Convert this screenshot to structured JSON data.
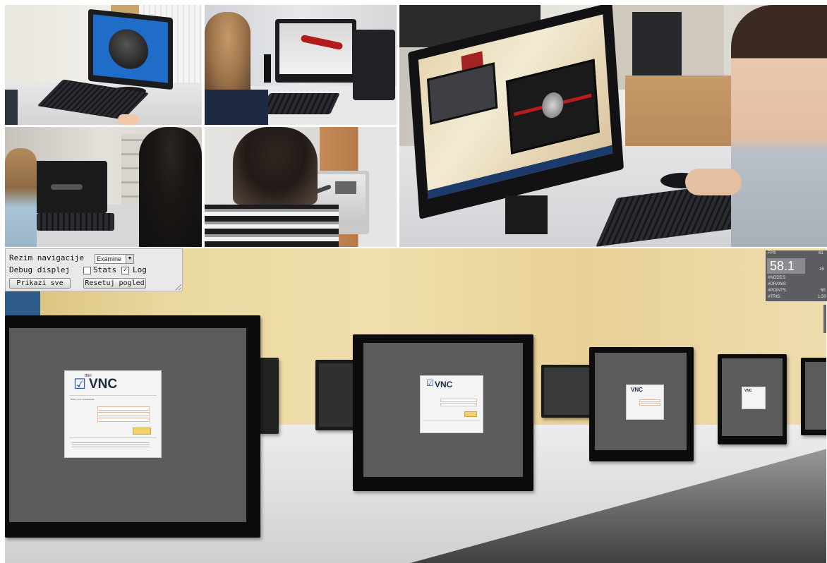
{
  "panel": {
    "nav_label": "Rezim navigacije",
    "nav_select": "Examine",
    "debug_label": "Debug displej",
    "stats_label": "Stats",
    "stats_checked": false,
    "log_label": "Log",
    "log_checked": true,
    "show_all_button": "Prikazi sve",
    "reset_view_button": "Resetuj pogled"
  },
  "stats": {
    "header_left": "FPS",
    "header_right": "61",
    "fps_value": "58.1",
    "fps_side": "16",
    "rows": [
      {
        "label": "#NODES:",
        "value": ""
      },
      {
        "label": "#DRAWS:",
        "value": ""
      },
      {
        "label": "#POINTS:",
        "value": "60"
      },
      {
        "label": "#TRIS:",
        "value": "1,50"
      }
    ]
  },
  "thinvnc": {
    "logo_small": "thin",
    "logo_big": "VNC",
    "enter_text": "Enter your credentials"
  },
  "colors": {
    "panel_bg": "#e9e9e9",
    "stats_bg": "#5b5d60",
    "monitor_screen": "#5b5b5b",
    "wall": "#ead8a0"
  }
}
